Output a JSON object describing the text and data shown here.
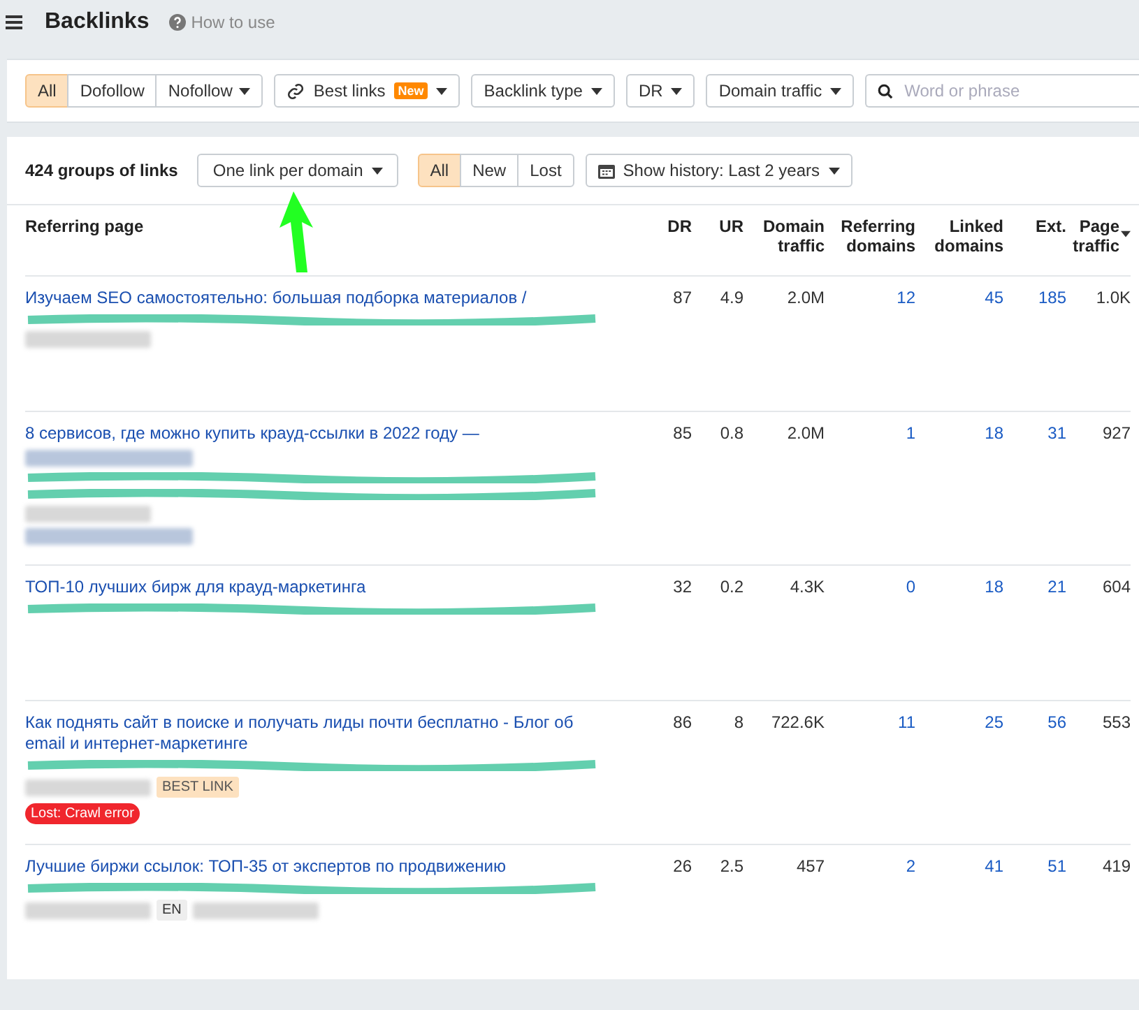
{
  "header": {
    "title": "Backlinks",
    "help": "How to use"
  },
  "filters": {
    "link_types": [
      {
        "label": "All",
        "selected": true
      },
      {
        "label": "Dofollow",
        "selected": false
      },
      {
        "label": "Nofollow",
        "selected": false,
        "dropdown": true
      }
    ],
    "dropdowns": [
      {
        "label": "Best links",
        "badge": "New",
        "kind": "link"
      },
      {
        "label": "Backlink type",
        "kind": "plain"
      },
      {
        "label": "DR",
        "kind": "plain"
      },
      {
        "label": "Domain traffic",
        "kind": "plain"
      }
    ],
    "search": {
      "placeholder": "Word or phrase"
    }
  },
  "summary": {
    "count": "424 groups of links",
    "grouping": "One link per domain",
    "status": [
      {
        "label": "All",
        "selected": true
      },
      {
        "label": "New",
        "selected": false
      },
      {
        "label": "Lost",
        "selected": false
      }
    ],
    "history": "Show history: Last 2 years"
  },
  "table": {
    "columns": [
      {
        "label": "Referring page",
        "sorted": false
      },
      {
        "label": "DR",
        "sorted": false
      },
      {
        "label": "UR",
        "sorted": false
      },
      {
        "label": "Domain traffic",
        "sorted": false
      },
      {
        "label": "Referring domains",
        "sorted": false
      },
      {
        "label": "Linked domains",
        "sorted": false
      },
      {
        "label": "Ext.",
        "sorted": false
      },
      {
        "label": "Page traffic",
        "sorted": true
      }
    ],
    "rows": [
      {
        "lines": [
          [
            {
              "kind": "scribble"
            }
          ],
          [
            {
              "kind": "blurchip"
            }
          ]
        ],
        "cells": [
          "Изучаем SEO самостоятельно: большая подборка материалов /",
          "87",
          "4.9",
          "2.0M",
          "12",
          "45",
          "185",
          "1.0K"
        ]
      },
      {
        "lines": [
          [
            {
              "kind": "blurline"
            }
          ],
          [
            {
              "kind": "scribble"
            }
          ],
          [
            {
              "kind": "scribble"
            }
          ],
          [
            {
              "kind": "blurchip"
            }
          ],
          [
            {
              "kind": "blurline"
            }
          ]
        ],
        "cells": [
          "8 сервисов, где можно купить крауд-ссылки в 2022 году —",
          "85",
          "0.8",
          "2.0M",
          "1",
          "18",
          "31",
          "927"
        ]
      },
      {
        "lines": [
          [
            {
              "kind": "scribble"
            }
          ]
        ],
        "cells": [
          "ТОП-10 лучших бирж для крауд-маркетинга",
          "32",
          "0.2",
          "4.3K",
          "0",
          "18",
          "21",
          "604"
        ]
      },
      {
        "lines": [
          [
            {
              "kind": "scribble"
            }
          ],
          [
            {
              "kind": "blurchip"
            },
            {
              "kind": "tag",
              "text": "BEST LINK"
            }
          ],
          [
            {
              "kind": "alert",
              "text": "Lost: Crawl error"
            }
          ]
        ],
        "cells": [
          "Как поднять сайт в поиске и получать лиды почти бесплатно - Блог об email и интернет-маркетинге",
          "86",
          "8",
          "722.6K",
          "11",
          "25",
          "56",
          "553"
        ]
      },
      {
        "lines": [
          [
            {
              "kind": "scribble"
            }
          ],
          [
            {
              "kind": "blurchip"
            },
            {
              "kind": "chip",
              "text": "EN"
            },
            {
              "kind": "blurchip"
            }
          ]
        ],
        "cells": [
          "Лучшие биржи ссылок: ТОП-35 от экспертов по продвижению",
          "26",
          "2.5",
          "457",
          "2",
          "41",
          "51",
          "419"
        ]
      }
    ]
  }
}
